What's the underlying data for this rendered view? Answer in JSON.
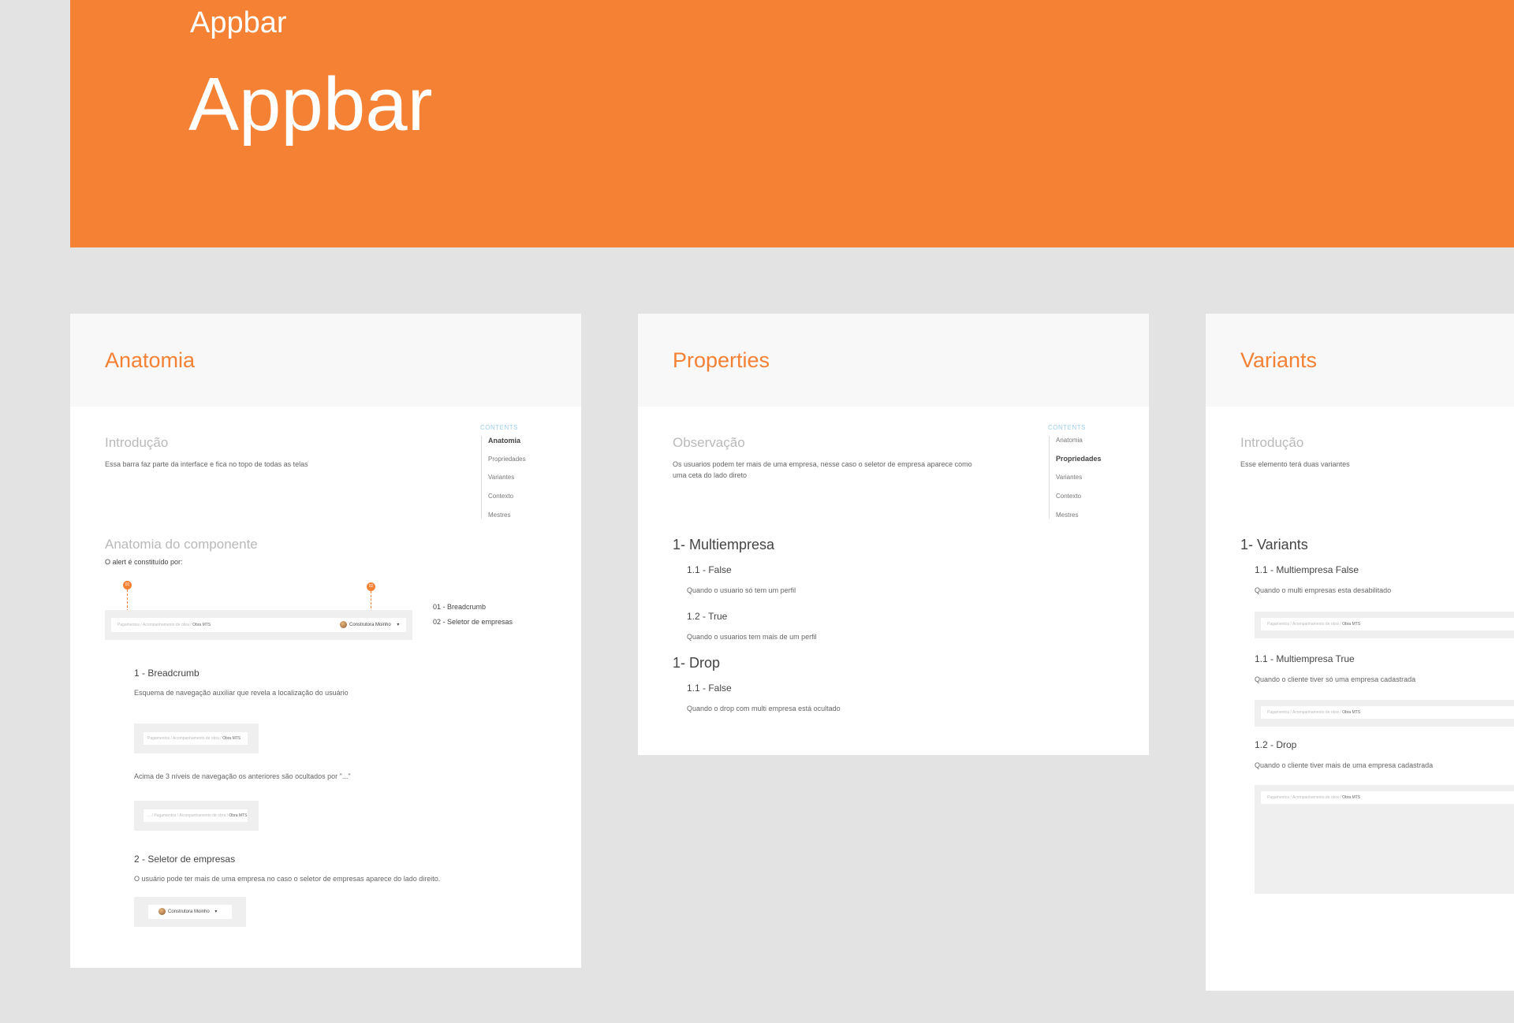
{
  "header": {
    "small_title": "Appbar",
    "big_title": "Appbar"
  },
  "cards": {
    "anatomia": {
      "title": "Anatomia",
      "intro_heading": "Introdução",
      "intro_text": "Essa barra faz parte da interface e fica no topo de todas as telas",
      "component_heading": "Anatomia do componente",
      "component_sub": "O alert é constituído por:",
      "legend": [
        "01 - Breadcrumb",
        "02 - Seletor de empresas"
      ],
      "markers": [
        "01",
        "02"
      ],
      "s1_title": "1 - Breadcrumb",
      "s1_text": "Esquema de navegação auxiliar que revela a localização do usuário",
      "s1_text2": "Acima de 3 níveis de navegação os anteriores são ocultados por \"...\"",
      "s2_title": "2 - Seletor de empresas",
      "s2_text": "O usuário pode ter mais de uma empresa no caso o seletor de empresas aparece do lado direito.",
      "mock_crumb": "Pagamentos / Acompanhamento de obra / ",
      "mock_crumb_current": "Obra MTS",
      "mock_crumb_short": "... / Pagamentos / Acompanhamento de obra / ",
      "company_name": "Construtora Moinho",
      "company_caret": "▾"
    },
    "properties": {
      "title": "Properties",
      "obs_heading": "Observação",
      "obs_text_1": "Os usuarios podem ter mais de uma empresa, nesse caso o seletor de empresa aparece como",
      "obs_text_2": "uma ceta do lado direto",
      "s1_title": "1- Multiempresa",
      "s1a_title": "1.1 - False",
      "s1a_text": "Quando o usuario só tem um perfil",
      "s1b_title": "1.2 - True",
      "s1b_text": "Quando o usuarios tem mais de um perfil",
      "s2_title": "1- Drop",
      "s2a_title": "1.1 - False",
      "s2a_text": "Quando o drop com multi empresa está ocultado"
    },
    "variants": {
      "title": "Variants",
      "intro_heading": "Introdução",
      "intro_text": "Esse elemento terá duas variantes",
      "s1_title": "1- Variants",
      "v1_title": "1.1 - Multiempresa False",
      "v1_text": "Quando o multi empresas esta desabilitado",
      "v2_title": "1.1 - Multiempresa True",
      "v2_text": "Quando o cliente tiver só uma empresa cadastrada",
      "v3_title": "1.2 - Drop",
      "v3_text": "Quando o cliente tiver mais de uma empresa cadastrada",
      "mock_crumb": "Pagamentos / Acompanhamento de obra / ",
      "mock_crumb_current": "Obra MTS"
    }
  },
  "toc": {
    "title": "CONTENTS",
    "items": [
      "Anatomia",
      "Propriedades",
      "Variantes",
      "Contexto",
      "Mestres"
    ]
  },
  "colors": {
    "accent": "#f48134",
    "background": "#e3e3e3",
    "toc_title": "#9fd0f0"
  }
}
